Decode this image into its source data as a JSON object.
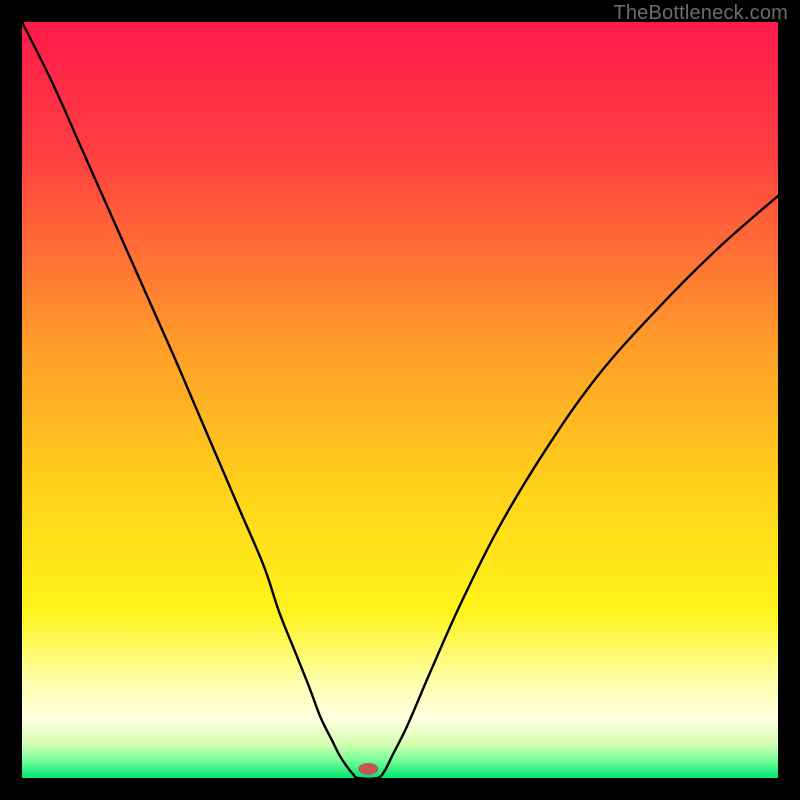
{
  "watermark": "TheBottleneck.com",
  "chart_data": {
    "type": "line",
    "title": "",
    "xlabel": "",
    "ylabel": "",
    "xlim": [
      0,
      100
    ],
    "ylim": [
      0,
      100
    ],
    "gradient_stops": [
      {
        "offset": 0.0,
        "color": "#ff1a4b"
      },
      {
        "offset": 0.18,
        "color": "#ff4040"
      },
      {
        "offset": 0.42,
        "color": "#ff9a2a"
      },
      {
        "offset": 0.62,
        "color": "#ffd21a"
      },
      {
        "offset": 0.78,
        "color": "#fff41a"
      },
      {
        "offset": 0.87,
        "color": "#ffffa8"
      },
      {
        "offset": 0.92,
        "color": "#ffffe0"
      },
      {
        "offset": 0.955,
        "color": "#d6ffb0"
      },
      {
        "offset": 0.975,
        "color": "#7dff9c"
      },
      {
        "offset": 1.0,
        "color": "#00e66e"
      }
    ],
    "series": [
      {
        "name": "bottleneck-curve",
        "x": [
          0,
          4,
          8,
          12,
          16,
          20,
          23,
          26,
          29,
          32,
          34,
          36,
          38,
          39.5,
          41,
          42,
          43,
          43.8,
          44.5,
          47,
          48,
          49,
          51,
          54,
          58,
          63,
          69,
          76,
          84,
          92,
          100
        ],
        "y": [
          100,
          92,
          83,
          74,
          65,
          56,
          49,
          42,
          35,
          28,
          22,
          17,
          12,
          8,
          5,
          3,
          1.5,
          0.5,
          0,
          0,
          1,
          3,
          7,
          14,
          23,
          33,
          43,
          53,
          62,
          70,
          77
        ]
      }
    ],
    "marker": {
      "x": 45.8,
      "y": 1.2,
      "color": "#c05a5a",
      "rx": 10,
      "ry": 6
    }
  }
}
